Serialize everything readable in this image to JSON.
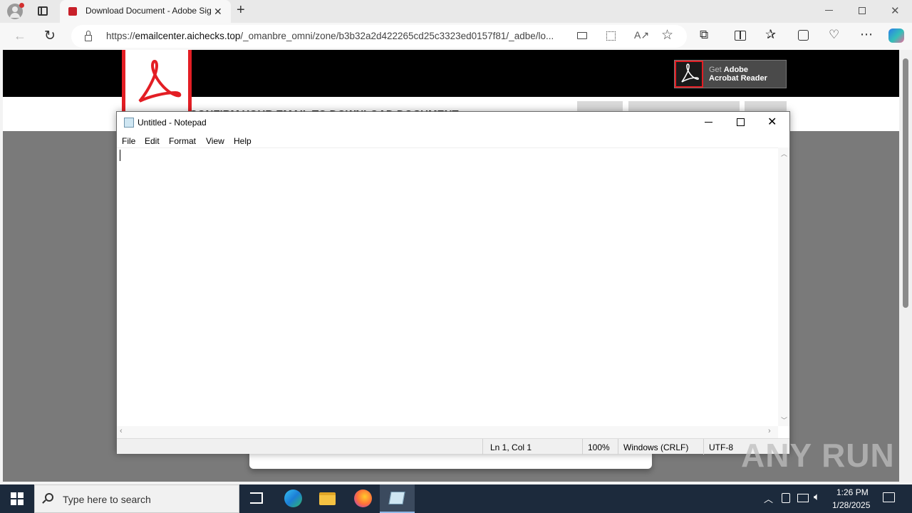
{
  "browser": {
    "tab_title": "Download Document - Adobe Sign",
    "url_host": "emailcenter.aichecks.top",
    "url_prefix": "https://",
    "url_path": "/_omanbre_omni/zone/b3b32a2d422265cd25c3323ed0157f81/_adbe/lo..."
  },
  "page": {
    "banner_get": "Get",
    "banner_adobe": "Adobe",
    "banner_reader": "Acrobat Reader",
    "heading_partial": "CONFIRM YOUR EMAIL TO DOWNLOAD DOCUMENT"
  },
  "notepad": {
    "title": "Untitled - Notepad",
    "menu": [
      "File",
      "Edit",
      "Format",
      "View",
      "Help"
    ],
    "status": {
      "position": "Ln 1, Col 1",
      "zoom": "100%",
      "line_ending": "Windows (CRLF)",
      "encoding": "UTF-8"
    }
  },
  "taskbar": {
    "search_placeholder": "Type here to search",
    "time": "1:26 PM",
    "date": "1/28/2025"
  },
  "watermark": "ANY RUN",
  "colors": {
    "adobe_red": "#e31e24",
    "taskbar": "#1c2a3c"
  }
}
